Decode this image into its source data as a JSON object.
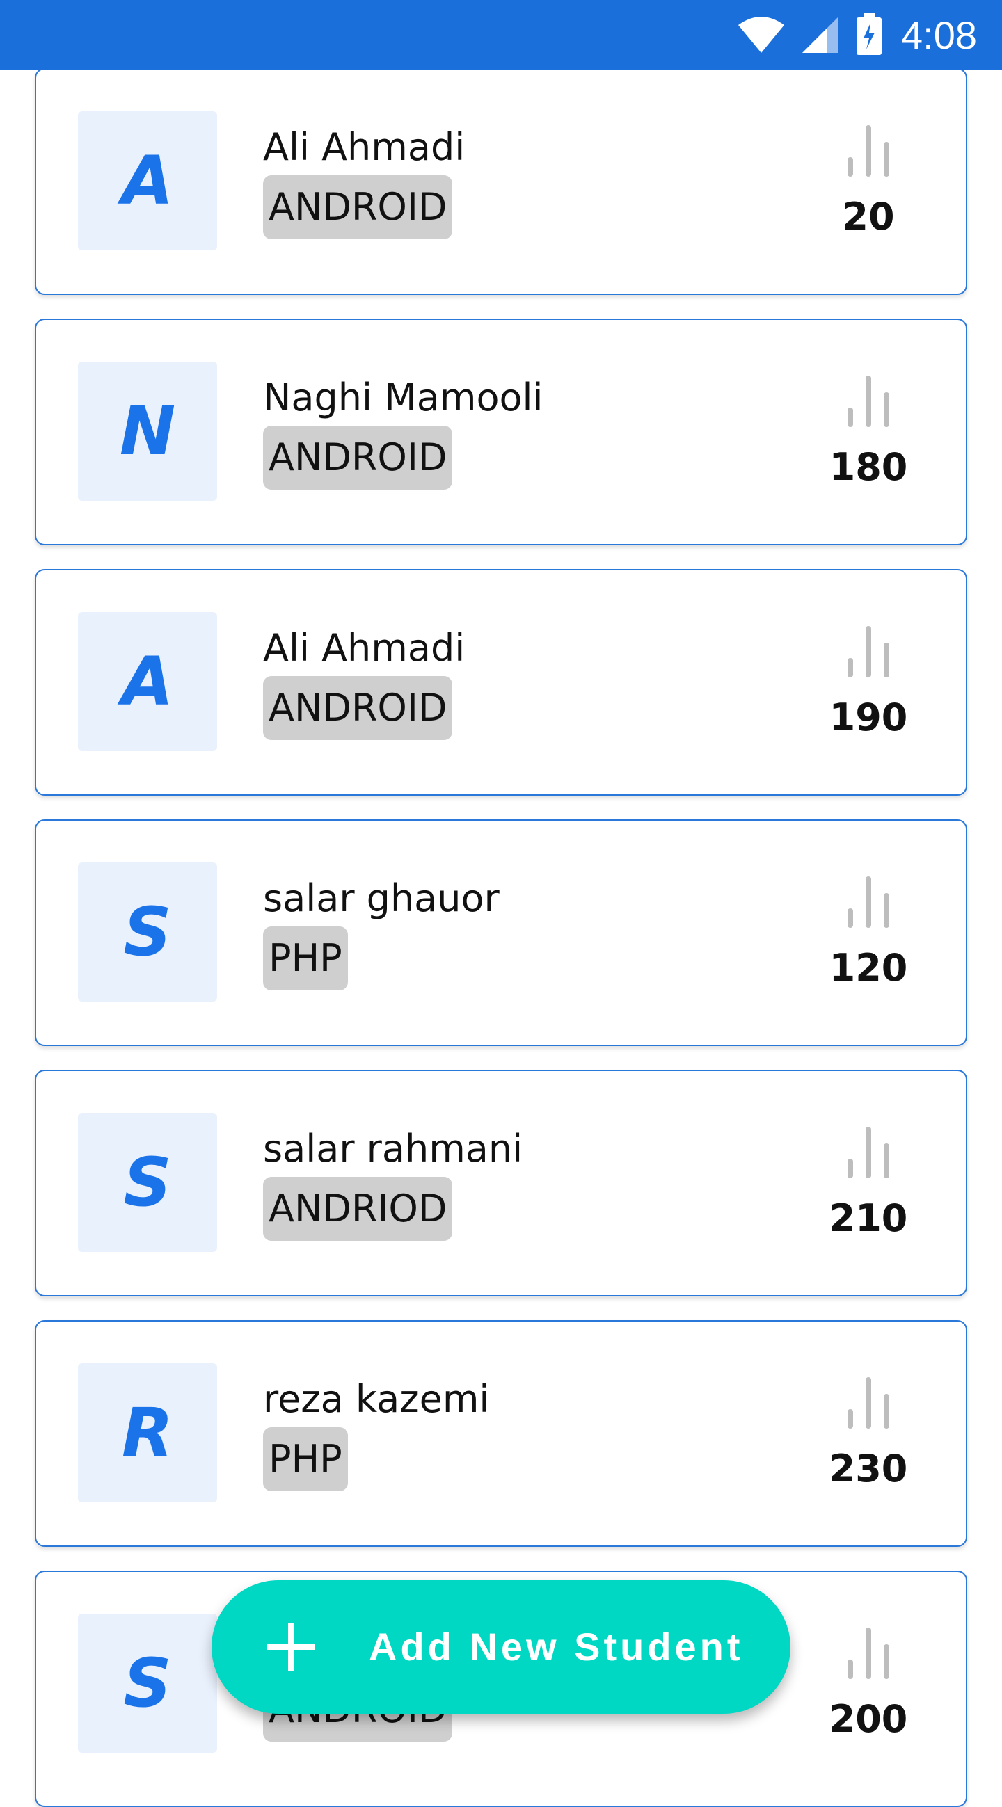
{
  "status_bar": {
    "time": "4:08",
    "icons": [
      "wifi-icon",
      "signal-icon",
      "battery-charging-icon"
    ],
    "background_color": "#1a6fdb"
  },
  "students": [
    {
      "initial": "A",
      "name": "Ali Ahmadi",
      "course": "ANDROID",
      "score": "20"
    },
    {
      "initial": "N",
      "name": "Naghi Mamooli",
      "course": "ANDROID",
      "score": "180"
    },
    {
      "initial": "A",
      "name": "Ali Ahmadi",
      "course": "ANDROID",
      "score": "190"
    },
    {
      "initial": "S",
      "name": "salar ghauor",
      "course": "PHP",
      "score": "120"
    },
    {
      "initial": "S",
      "name": "salar rahmani",
      "course": "ANDRIOD",
      "score": "210"
    },
    {
      "initial": "R",
      "name": "reza kazemi",
      "course": "PHP",
      "score": "230"
    },
    {
      "initial": "S",
      "name": "",
      "course": "ANDROID",
      "score": "200"
    }
  ],
  "fab": {
    "label": "Add New Student",
    "icon": "plus-icon",
    "color": "#00d8c4"
  },
  "colors": {
    "accent": "#1a73e8",
    "card_border": "#2a78d9",
    "avatar_bg": "#e9f1fd",
    "badge_bg": "#cfcfcf",
    "score_icon": "#bdbdbd"
  }
}
